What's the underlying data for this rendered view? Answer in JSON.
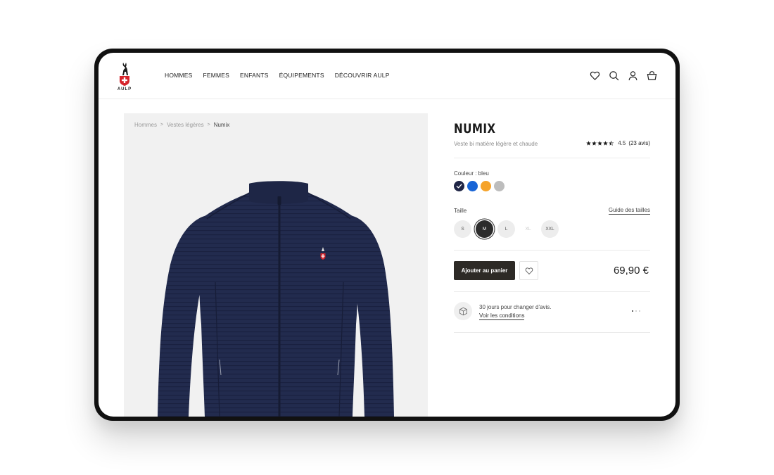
{
  "brand": {
    "logo_text": "AULP"
  },
  "nav": {
    "items": [
      {
        "label": "HOMMES"
      },
      {
        "label": "FEMMES"
      },
      {
        "label": "ENFANTS"
      },
      {
        "label": "ÉQUIPEMENTS"
      },
      {
        "label": "DÉCOUVRIR AULP"
      }
    ]
  },
  "header_icons": [
    "heart-icon",
    "search-icon",
    "user-icon",
    "basket-icon"
  ],
  "breadcrumb": {
    "items": [
      "Hommes",
      "Vestes légères",
      "Numix"
    ],
    "separator": ">"
  },
  "product": {
    "name": "NUMIX",
    "subtitle": "Veste bi matière légère et chaude",
    "rating": {
      "stars": 4.5,
      "score": "4.5",
      "count": "(23 avis)"
    },
    "color": {
      "label": "Couleur : bleu",
      "swatches": [
        {
          "name": "navy",
          "hex": "#1f2545",
          "selected": true
        },
        {
          "name": "blue",
          "hex": "#1764d6",
          "selected": false
        },
        {
          "name": "orange",
          "hex": "#f5a32a",
          "selected": false
        },
        {
          "name": "grey",
          "hex": "#bdbdbd",
          "selected": false
        }
      ]
    },
    "size": {
      "label": "Taille",
      "guide_label": "Guide des tailles",
      "options": [
        {
          "label": "S",
          "state": "available"
        },
        {
          "label": "M",
          "state": "selected"
        },
        {
          "label": "L",
          "state": "available"
        },
        {
          "label": "XL",
          "state": "unavailable"
        },
        {
          "label": "XXL",
          "state": "available"
        }
      ]
    },
    "add_to_cart_label": "Ajouter au panier",
    "price": "69,90 €",
    "jacket_color": "#222b4e"
  },
  "promo": {
    "text": "30 jours pour changer d'avis.",
    "link_label": "Voir les conditions",
    "slides": 3,
    "active_slide": 0
  },
  "colors": {
    "accent_dark": "#2d2a26",
    "frame": "#111111"
  }
}
